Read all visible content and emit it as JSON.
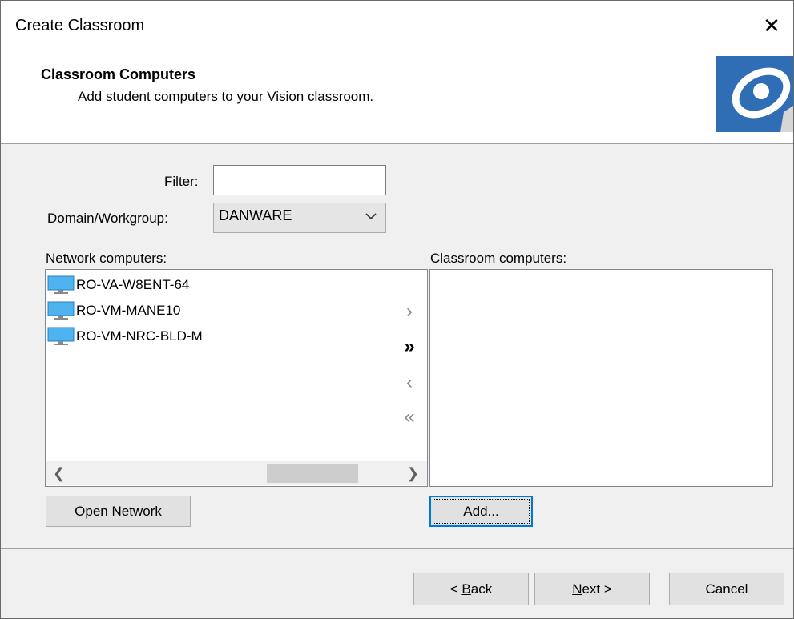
{
  "window": {
    "title": "Create Classroom"
  },
  "header": {
    "title": "Classroom Computers",
    "subtitle": "Add student computers to your Vision classroom."
  },
  "filter": {
    "label": "Filter:",
    "value": ""
  },
  "domain": {
    "label": "Domain/Workgroup:",
    "selected": "DANWARE"
  },
  "network": {
    "label": "Network computers:",
    "items": [
      {
        "name": "RO-VA-W8ENT-64",
        "icon": "computer-icon"
      },
      {
        "name": "RO-VM-MANE10",
        "icon": "computer-icon"
      },
      {
        "name": "RO-VM-NRC-BLD-M",
        "icon": "computer-icon"
      }
    ]
  },
  "classroom": {
    "label": "Classroom computers:",
    "items": []
  },
  "move": {
    "add_one": "›",
    "add_all": "»",
    "remove_one": "‹",
    "remove_all": "«"
  },
  "buttons": {
    "open_network": "Open Network",
    "add_mnemonic": "A",
    "add_rest": "dd...",
    "back_prefix": "< ",
    "back_mnemonic": "B",
    "back_rest": "ack",
    "next_mnemonic": "N",
    "next_rest": "ext >",
    "cancel": "Cancel"
  },
  "colors": {
    "accent": "#0078d7",
    "logo_blue": "#2f6db5"
  }
}
